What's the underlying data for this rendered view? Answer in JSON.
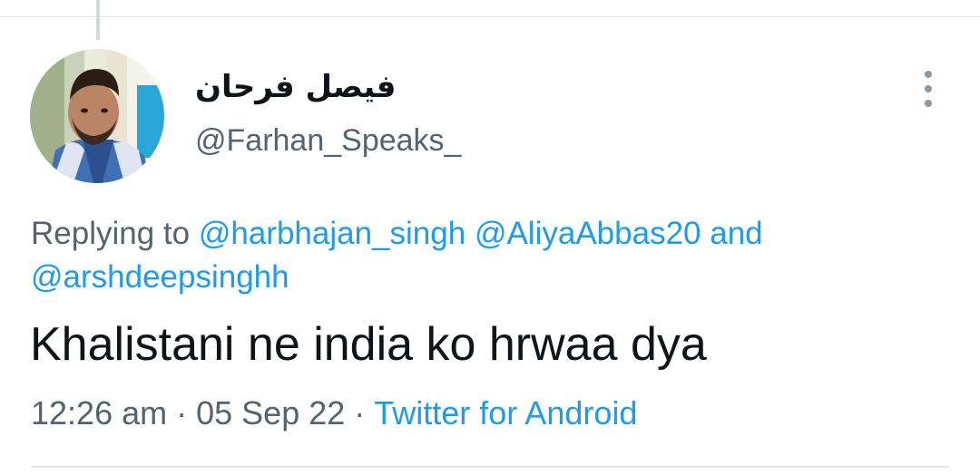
{
  "tweet": {
    "author": {
      "display_name": "فیصل فرحان",
      "handle": "@Farhan_Speaks_"
    },
    "reply": {
      "prefix": "Replying to",
      "mentions": [
        "@harbhajan_singh",
        "@AliyaAbbas20"
      ],
      "conjunction": "and",
      "last_mention": "@arshdeepsinghh"
    },
    "text": "Khalistani ne india ko hrwaa dya",
    "meta": {
      "time": "12:26 am",
      "separator": "·",
      "date": "05 Sep 22",
      "source": "Twitter for Android"
    },
    "icons": {
      "avatar": "profile-photo",
      "more": "more-vertical-icon"
    },
    "colors": {
      "link": "#1d9bf0",
      "secondary_text": "#536471",
      "primary_text": "#0f1419",
      "divider": "#e1e8ed"
    }
  }
}
